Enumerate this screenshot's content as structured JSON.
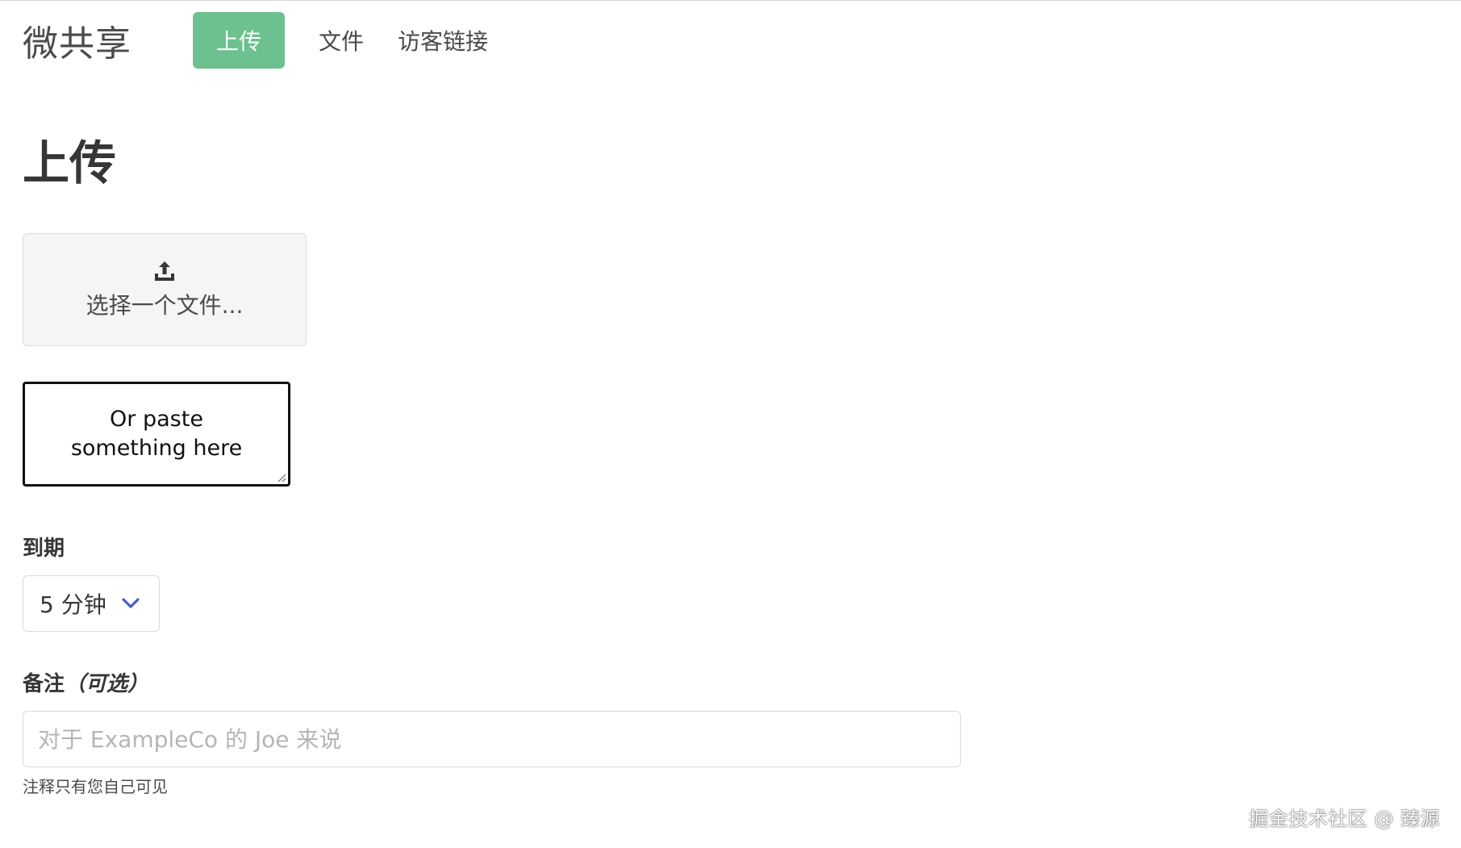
{
  "navbar": {
    "brand": "微共享",
    "upload_button": "上传",
    "files_link": "文件",
    "guest_links_link": "访客链接"
  },
  "page": {
    "title": "上传"
  },
  "file_chooser": {
    "icon": "upload-icon",
    "label": "选择一个文件..."
  },
  "paste_area": {
    "placeholder": "Or paste something here"
  },
  "expiry": {
    "label": "到期",
    "selected": "5 分钟"
  },
  "note": {
    "label": "备注",
    "optional": "（可选）",
    "placeholder": "对于 ExampleCo 的 Joe 来说",
    "value": "",
    "help": "注释只有您自己可见"
  },
  "watermark": "掘金技术社区 @ 臻源",
  "colors": {
    "accent": "#6cc18e",
    "chevron": "#485fc7",
    "text": "#363636",
    "border": "#dbdbdb"
  }
}
